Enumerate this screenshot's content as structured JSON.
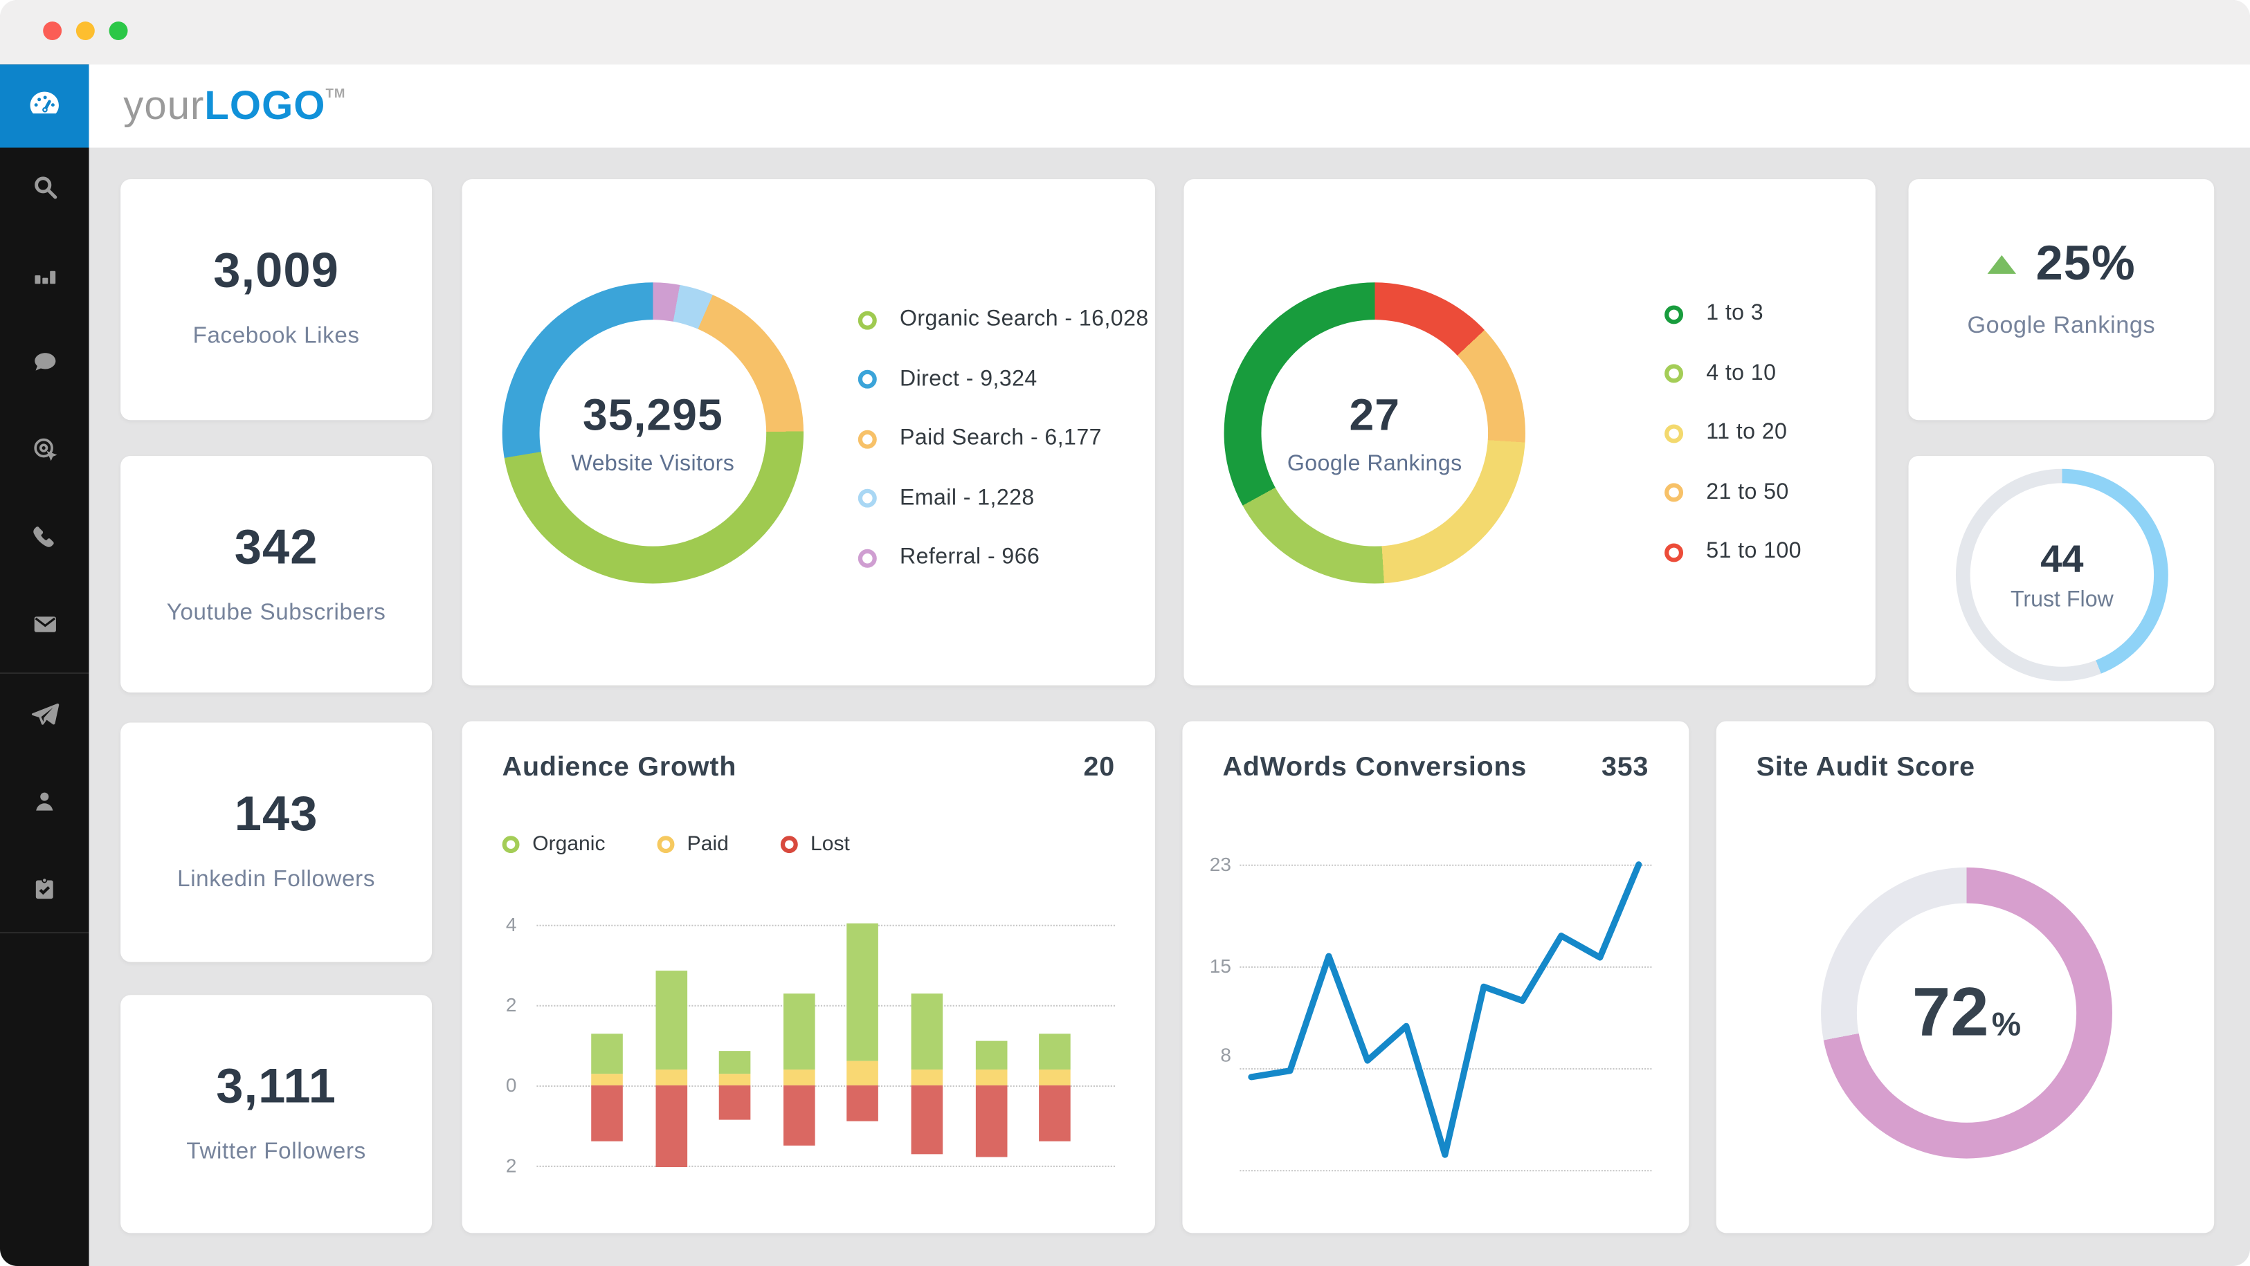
{
  "window": {
    "traffic_lights": [
      {
        "name": "close",
        "color": "#fb5d55"
      },
      {
        "name": "minimize",
        "color": "#fdbe2f"
      },
      {
        "name": "zoom",
        "color": "#2bc747"
      }
    ]
  },
  "header": {
    "logo_prefix": "your",
    "logo_main": "LOGO",
    "logo_tm": "TM"
  },
  "sidebar": {
    "active_color": "#0d84cb",
    "items": [
      {
        "id": "dashboard",
        "icon": "gauge-icon",
        "active": true
      },
      {
        "id": "search",
        "icon": "search-icon",
        "active": false
      },
      {
        "id": "analytics",
        "icon": "bar-chart-icon",
        "active": false
      },
      {
        "id": "messages",
        "icon": "chat-icon",
        "active": false
      },
      {
        "id": "goals",
        "icon": "target-click-icon",
        "active": false
      },
      {
        "id": "calls",
        "icon": "phone-icon",
        "active": false
      },
      {
        "id": "email",
        "icon": "envelope-icon",
        "active": false
      },
      {
        "id": "campaigns",
        "icon": "paper-plane-icon",
        "active": false
      },
      {
        "id": "profile",
        "icon": "user-icon",
        "active": false
      },
      {
        "id": "tasks",
        "icon": "clipboard-check-icon",
        "active": false
      }
    ]
  },
  "stats": [
    {
      "value": "3,009",
      "label": "Facebook Likes"
    },
    {
      "value": "342",
      "label": "Youtube Subscribers"
    },
    {
      "value": "143",
      "label": "Linkedin Followers"
    },
    {
      "value": "3,111",
      "label": "Twitter Followers"
    }
  ],
  "website_visitors": {
    "total": "35,295",
    "label": "Website Visitors",
    "chart_data": {
      "type": "pie",
      "title": "Website Visitors",
      "series": [
        {
          "name": "Organic Search",
          "value": 16028,
          "display": "Organic Search - 16,028",
          "color": "#9fca50"
        },
        {
          "name": "Direct",
          "value": 9324,
          "display": "Direct - 9,324",
          "color": "#3ba4d9"
        },
        {
          "name": "Paid Search",
          "value": 6177,
          "display": "Paid Search - 6,177",
          "color": "#f7c168"
        },
        {
          "name": "Email",
          "value": 1228,
          "display": "Email - 1,228",
          "color": "#a9d7f4"
        },
        {
          "name": "Referral",
          "value": 966,
          "display": "Referral - 966",
          "color": "#cf9ed1"
        }
      ],
      "draw_order_from_top": [
        "Referral",
        "Email",
        "Paid Search",
        "Organic Search",
        "Direct"
      ]
    }
  },
  "google_rankings": {
    "total": "27",
    "label": "Google Rankings",
    "chart_data": {
      "type": "pie",
      "title": "Google Rankings",
      "series": [
        {
          "name": "1 to 3",
          "percent": 33,
          "color": "#189c3d"
        },
        {
          "name": "4 to 10",
          "percent": 18,
          "color": "#a4cd57"
        },
        {
          "name": "11 to 20",
          "percent": 23,
          "color": "#f3d96e"
        },
        {
          "name": "21 to 50",
          "percent": 13,
          "color": "#f7c168"
        },
        {
          "name": "51 to 100",
          "percent": 13,
          "color": "#ec4c39"
        }
      ],
      "draw_order_from_top": [
        "51 to 100",
        "21 to 50",
        "11 to 20",
        "4 to 10",
        "1 to 3"
      ]
    }
  },
  "rankings_change": {
    "value": "25%",
    "label": "Google Rankings",
    "trend": "up",
    "trend_color": "#79bd61"
  },
  "trust_flow": {
    "value": "44",
    "label": "Trust Flow",
    "chart_data": {
      "type": "donut",
      "percent": 44,
      "color": "#8fd3f7",
      "track": "#e4e7ec"
    }
  },
  "audience_growth": {
    "title": "Audience Growth",
    "value": "20",
    "legend": [
      {
        "name": "Organic",
        "color": "#a4cd57"
      },
      {
        "name": "Paid",
        "color": "#f6c95f"
      },
      {
        "name": "Lost",
        "color": "#d8493d"
      }
    ],
    "chart_data": {
      "type": "bar",
      "stacked": true,
      "ylim": [
        -2,
        4
      ],
      "ytick_labels": [
        "4",
        "2",
        "0",
        "2"
      ],
      "grid": "dotted",
      "colors": {
        "organic": "#aed36e",
        "paid": "#f9d873",
        "lost": "#da6862"
      },
      "bars": [
        {
          "organic": 1.3,
          "paid": 0.3,
          "lost": -1.4
        },
        {
          "organic": 2.85,
          "paid": 0.4,
          "lost": -2.05
        },
        {
          "organic": 0.85,
          "paid": 0.3,
          "lost": -0.85
        },
        {
          "organic": 2.3,
          "paid": 0.4,
          "lost": -1.5
        },
        {
          "organic": 4.05,
          "paid": 0.6,
          "lost": -0.9
        },
        {
          "organic": 2.3,
          "paid": 0.4,
          "lost": -1.7
        },
        {
          "organic": 1.1,
          "paid": 0.4,
          "lost": -1.8
        },
        {
          "organic": 1.3,
          "paid": 0.4,
          "lost": -1.4
        }
      ]
    }
  },
  "adwords": {
    "title": "AdWords Conversions",
    "value": "353",
    "chart_data": {
      "type": "line",
      "color": "#1588c9",
      "ytick_labels": [
        "23",
        "15",
        "8"
      ],
      "y_top_gridline": 23,
      "y_step_per_gridline": 8,
      "grid": "dotted",
      "values": [
        6.3,
        6.8,
        15.8,
        7.6,
        10.3,
        0.2,
        13.4,
        12.3,
        17.4,
        15.7,
        23
      ]
    }
  },
  "site_audit": {
    "title": "Site Audit Score",
    "value": "72",
    "unit": "%",
    "chart_data": {
      "type": "donut",
      "percent": 72,
      "color": "#d79fce",
      "track": "#e7e8ee"
    }
  }
}
